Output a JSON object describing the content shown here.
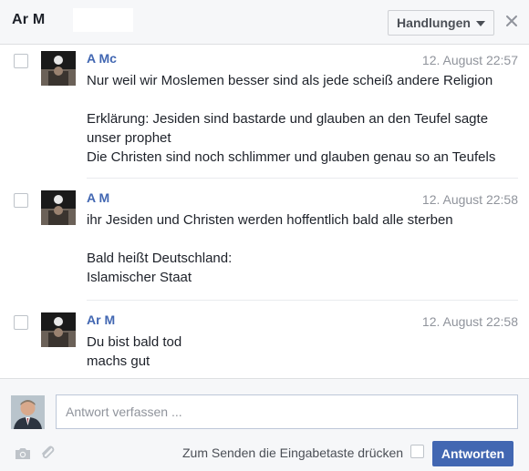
{
  "header": {
    "title": "Ar      M",
    "actions_label": "Handlungen",
    "close_symbol": "✕"
  },
  "messages": [
    {
      "sender": "A        Mc",
      "time": "12. August 22:57",
      "lines": [
        "Nur weil wir Moslemen besser sind als jede scheiß andere Religion",
        "",
        "Erklärung: Jesiden sind bastarde und glauben an den Teufel sagte",
        "unser prophet",
        "Die Christen sind noch schlimmer und glauben genau so an Teufels"
      ]
    },
    {
      "sender": "A        M",
      "time": "12. August 22:58",
      "lines": [
        "ihr Jesiden und Christen werden hoffentlich bald alle sterben",
        "",
        "Bald heißt Deutschland:",
        "Islamischer Staat"
      ]
    },
    {
      "sender": "Ar       M",
      "time": "12. August 22:58",
      "lines": [
        "Du bist bald tod",
        "machs gut"
      ]
    }
  ],
  "composer": {
    "placeholder": "Antwort verfassen ...",
    "enter_to_send_label": "Zum Senden die Eingabetaste drücken",
    "send_label": "Antworten"
  },
  "colors": {
    "accent": "#4267b2",
    "timestamp": "#90949c",
    "header_bg": "#f6f7f9"
  },
  "icons": {
    "close": "close-icon",
    "caret": "caret-down-icon",
    "camera": "camera-icon",
    "attach": "paperclip-icon"
  }
}
